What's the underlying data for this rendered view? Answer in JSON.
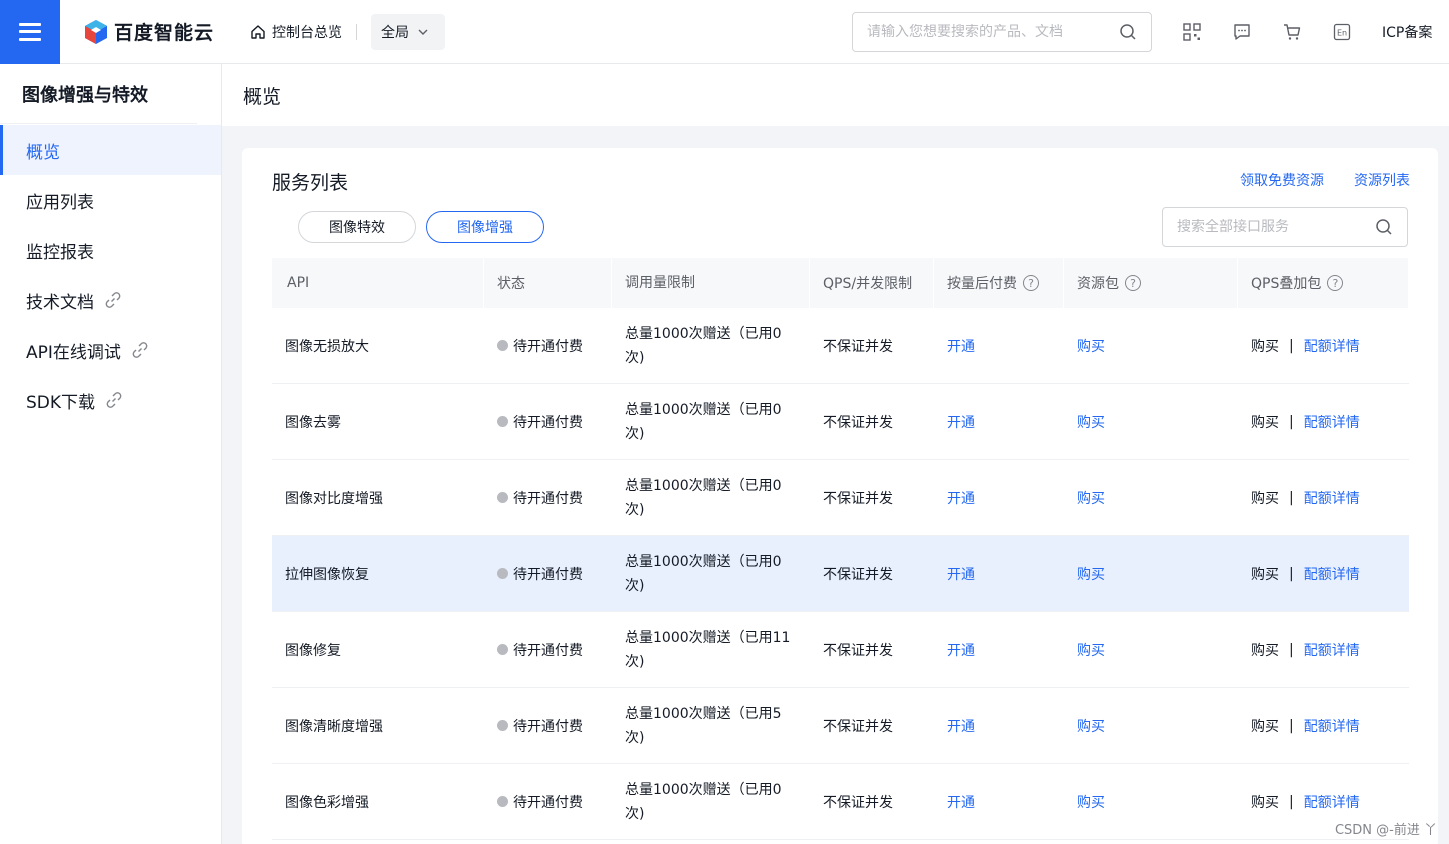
{
  "topbar": {
    "brand": "百度智能云",
    "home_label": "控制台总览",
    "region_label": "全局",
    "search_placeholder": "请输入您想要搜索的产品、文档",
    "icp_label": "ICP备案"
  },
  "sidebar": {
    "title": "图像增强与特效",
    "items": [
      {
        "label": "概览"
      },
      {
        "label": "应用列表"
      },
      {
        "label": "监控报表"
      },
      {
        "label": "技术文档"
      },
      {
        "label": "API在线调试"
      },
      {
        "label": "SDK下载"
      }
    ]
  },
  "page": {
    "title": "概览"
  },
  "card": {
    "title": "服务列表",
    "link_free": "领取免费资源",
    "link_resources": "资源列表",
    "tabs": [
      "图像特效",
      "图像增强"
    ],
    "search_placeholder": "搜索全部接口服务"
  },
  "table": {
    "headers": [
      "API",
      "状态",
      "调用量限制",
      "QPS/并发限制",
      "按量后付费",
      "资源包",
      "QPS叠加包"
    ],
    "rows": [
      {
        "api": "图像无损放大",
        "status": "待开通付费",
        "limit": "总量1000次赠送（已用0次)",
        "qps": "不保证并发",
        "open": "开通",
        "buy": "购买",
        "qps_buy": "购买",
        "detail": "配额详情"
      },
      {
        "api": "图像去雾",
        "status": "待开通付费",
        "limit": "总量1000次赠送（已用0次)",
        "qps": "不保证并发",
        "open": "开通",
        "buy": "购买",
        "qps_buy": "购买",
        "detail": "配额详情"
      },
      {
        "api": "图像对比度增强",
        "status": "待开通付费",
        "limit": "总量1000次赠送（已用0次)",
        "qps": "不保证并发",
        "open": "开通",
        "buy": "购买",
        "qps_buy": "购买",
        "detail": "配额详情"
      },
      {
        "api": "拉伸图像恢复",
        "status": "待开通付费",
        "limit": "总量1000次赠送（已用0次)",
        "qps": "不保证并发",
        "open": "开通",
        "buy": "购买",
        "qps_buy": "购买",
        "detail": "配额详情"
      },
      {
        "api": "图像修复",
        "status": "待开通付费",
        "limit": "总量1000次赠送（已用11次)",
        "qps": "不保证并发",
        "open": "开通",
        "buy": "购买",
        "qps_buy": "购买",
        "detail": "配额详情"
      },
      {
        "api": "图像清晰度增强",
        "status": "待开通付费",
        "limit": "总量1000次赠送（已用5次)",
        "qps": "不保证并发",
        "open": "开通",
        "buy": "购买",
        "qps_buy": "购买",
        "detail": "配额详情"
      },
      {
        "api": "图像色彩增强",
        "status": "待开通付费",
        "limit": "总量1000次赠送（已用0次)",
        "qps": "不保证并发",
        "open": "开通",
        "buy": "购买",
        "qps_buy": "购买",
        "detail": "配额详情"
      }
    ]
  },
  "watermark": "CSDN @-前进 丫",
  "colors": {
    "accent": "#2468f2",
    "highlight_row": "#e8f0fe",
    "status_dot": "#b8babf"
  }
}
